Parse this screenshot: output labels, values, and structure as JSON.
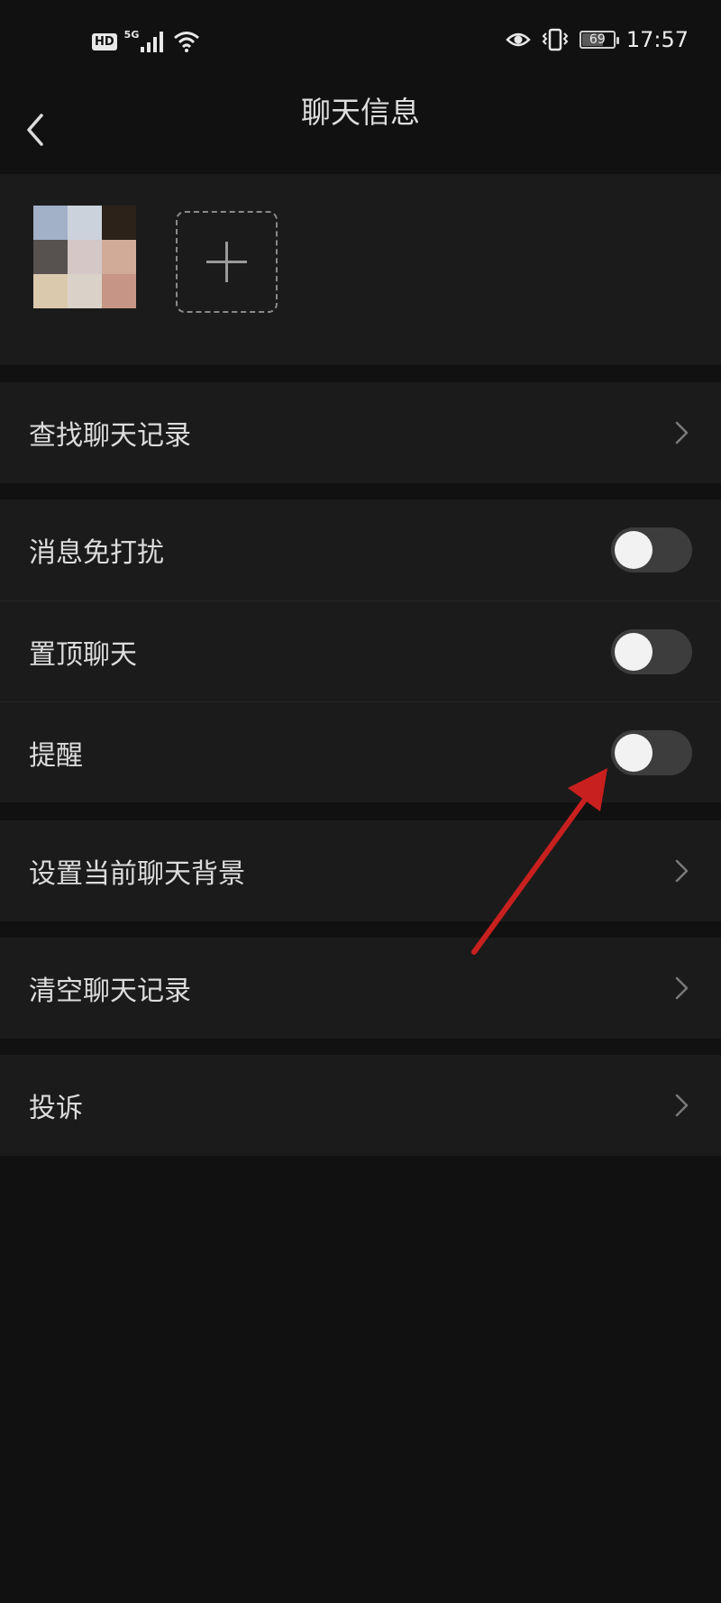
{
  "status_bar": {
    "hd": "HD",
    "network": "5G",
    "battery_level": "69",
    "battery_fraction": 0.69,
    "time": "17:57",
    "icons": [
      "signal-icon",
      "wifi-icon",
      "eye-icon",
      "vibrate-icon",
      "battery-icon"
    ]
  },
  "header": {
    "title": "聊天信息",
    "back_icon": "chevron-left-icon"
  },
  "members": {
    "avatar_colors": [
      "#a2b0c8",
      "#ccd2dc",
      "#2c2219",
      "#575250",
      "#d5c7c6",
      "#d1aa98",
      "#dbc9ae",
      "#dad2c8",
      "#c69585"
    ],
    "add_icon": "plus-icon"
  },
  "menu": {
    "search_history": "查找聊天记录",
    "mute": "消息免打扰",
    "mute_on": false,
    "pin": "置顶聊天",
    "pin_on": false,
    "remind": "提醒",
    "remind_on": false,
    "background": "设置当前聊天背景",
    "clear_history": "清空聊天记录",
    "report": "投诉"
  },
  "colors": {
    "background": "#111111",
    "section": "#1b1b1b",
    "toggle_off": "#3d3d3d",
    "annotation_arrow": "#c8201e"
  }
}
